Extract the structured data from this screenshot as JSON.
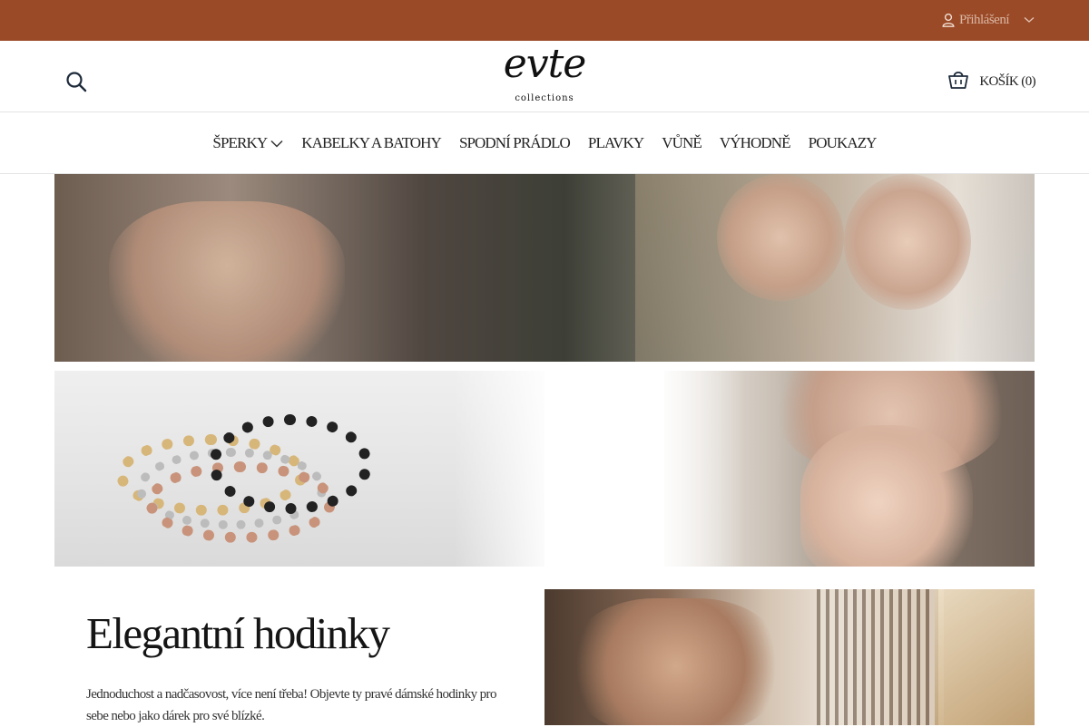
{
  "topbar": {
    "login_label": "Přihlášení",
    "background": "#9b4a27",
    "icons": {
      "user": "user-icon",
      "chevron": "chevron-down-icon"
    }
  },
  "header": {
    "logo": {
      "script": "evte",
      "sub": "collections"
    },
    "cart_label": "KOŠÍK (0)",
    "icons": {
      "search": "search-icon",
      "cart": "shopping-basket-icon"
    }
  },
  "nav": {
    "items": [
      {
        "label": "ŠPERKY",
        "has_dropdown": true
      },
      {
        "label": "KABELKY A BATOHY"
      },
      {
        "label": "SPODNÍ PRÁDLO"
      },
      {
        "label": "PLAVKY"
      },
      {
        "label": "VŮNĚ"
      },
      {
        "label": "VÝHODNĚ"
      },
      {
        "label": "POUKAZY"
      }
    ]
  },
  "promo": {
    "headline": "Elegantní hodinky",
    "description": "Jednoduchost a nadčasovost, více není třeba! Objevte ty pravé dámské hodinky pro sebe nebo jako dárek pro své blízké."
  }
}
